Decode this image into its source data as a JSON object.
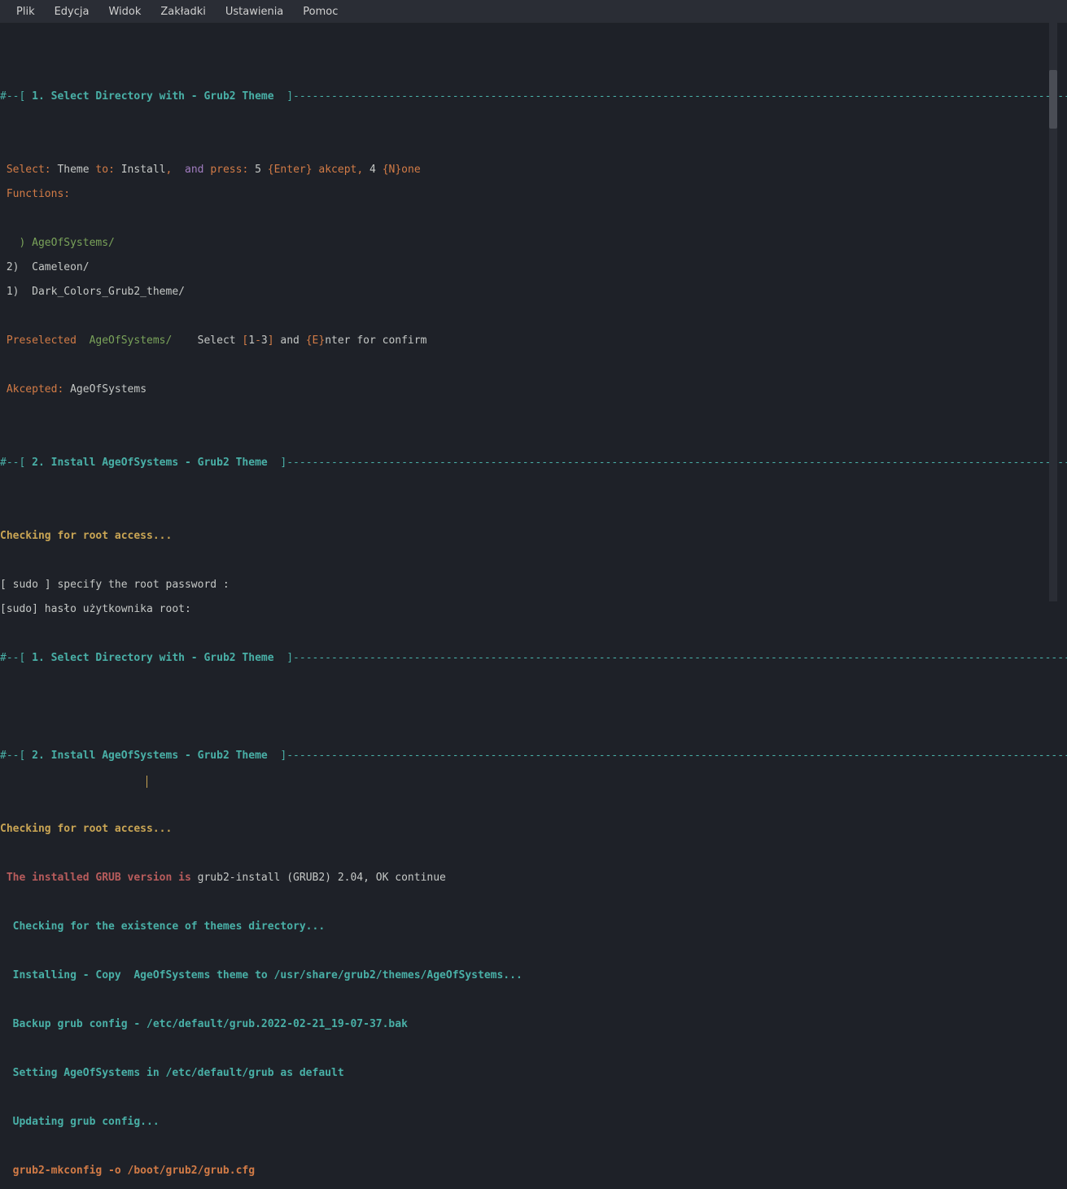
{
  "menu": {
    "items": [
      "Plik",
      "Edycja",
      "Widok",
      "Zakładki",
      "Ustawienia",
      "Pomoc"
    ]
  },
  "term": {
    "h1_prefix": "#--[ ",
    "h1_title": "1. Select Directory with - Grub2 Theme",
    "h1_suffix": "  ]",
    "dash_fill_1": "-----------------------------------------------------------------------------------------------------------------------------------#",
    "sel_select": " Select:",
    "sel_theme": " Theme ",
    "sel_to": "to:",
    "sel_install": " Install",
    "sel_comma": ",  ",
    "sel_and": "and",
    "sel_press": " press:",
    "sel_5": " 5 ",
    "sel_enter": "{Enter}",
    "sel_akcept": " akcept,",
    "sel_4": " 4 ",
    "sel_none": "{N}one",
    "functions": " Functions:",
    "opt_sel": "   ) AgeOfSystems/",
    "opt_2": " 2)  Cameleon/",
    "opt_1": " 1)  Dark_Colors_Grub2_theme/",
    "pre_label": " Preselected",
    "pre_val": "  AgeOfSystems/",
    "pre_sel": "    Select ",
    "pre_b1": "[",
    "pre_1": "1",
    "pre_dash": "-",
    "pre_3": "3",
    "pre_b2": "]",
    "pre_and": " and ",
    "pre_e": "{E}",
    "pre_rest": "nter for confirm",
    "akc_label": " Akcepted:",
    "akc_val": " AgeOfSystems",
    "h2_title": "2. Install AgeOfSystems - Grub2 Theme",
    "dash_fill_2": "------------------------------------------------------------------------------------------------------------------------------------#",
    "checking": "Checking for root access...",
    "sudo_line1": "[ sudo ] specify the root password :",
    "sudo_line2": "[sudo] hasło użytkownika root:",
    "grub_label": " The installed GRUB version is ",
    "grub_val": "grub2-install (GRUB2) 2.04, OK continue",
    "check_themes": "  Checking for the existence of themes directory...",
    "installing": "  Installing - Copy  AgeOfSystems theme to /usr/share/grub2/themes/AgeOfSystems...",
    "backup": "  Backup grub config - /etc/default/grub.2022-02-21_19-07-37.bak",
    "setting": "  Setting AgeOfSystems in /etc/default/grub as default",
    "updating": "  Updating grub config...",
    "mkconfig": "  grub2-mkconfig -o /boot/grub2/grub.cfg"
  }
}
